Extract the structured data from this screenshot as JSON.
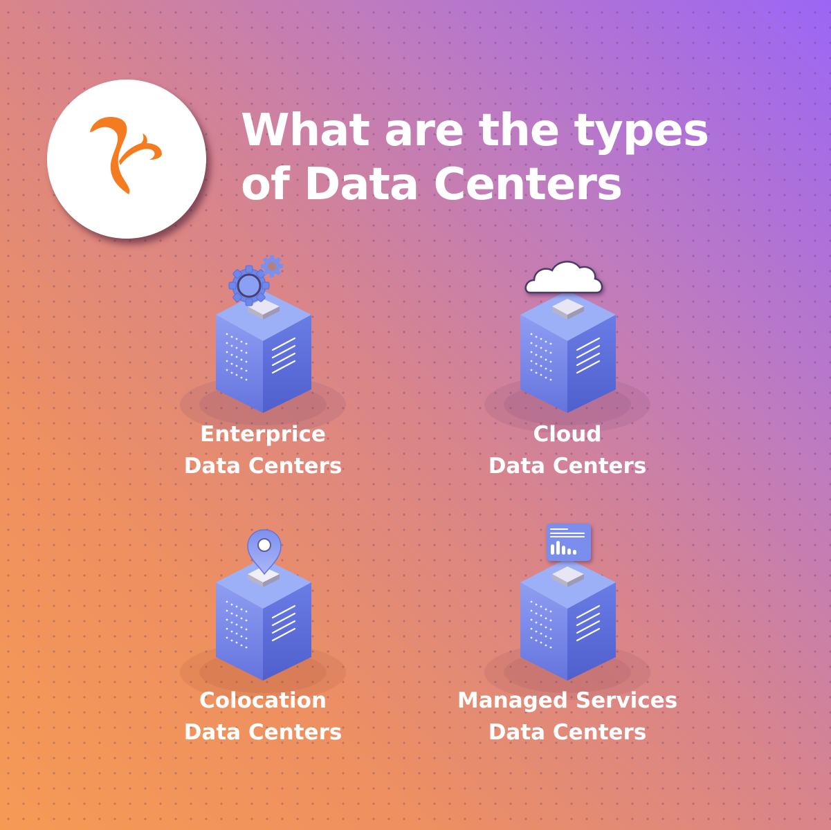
{
  "header": {
    "logo_icon": "squirrel-logo-icon",
    "title_line1": "What are the types",
    "title_line2": "of Data Centers"
  },
  "colors": {
    "gradient_start": "#f59a55",
    "gradient_end": "#9c66f5",
    "logo_accent": "#f47b20",
    "server_front": "#6f82e6",
    "server_side": "#5566d6",
    "text": "#ffffff"
  },
  "types": [
    {
      "icon": "gears-icon",
      "line1": "Enterprice",
      "line2": "Data Centers"
    },
    {
      "icon": "cloud-icon",
      "line1": "Cloud",
      "line2": "Data Centers"
    },
    {
      "icon": "location-pin-icon",
      "line1": "Colocation",
      "line2": "Data Centers"
    },
    {
      "icon": "dashboard-chart-icon",
      "line1": "Managed Services",
      "line2": "Data Centers"
    }
  ]
}
